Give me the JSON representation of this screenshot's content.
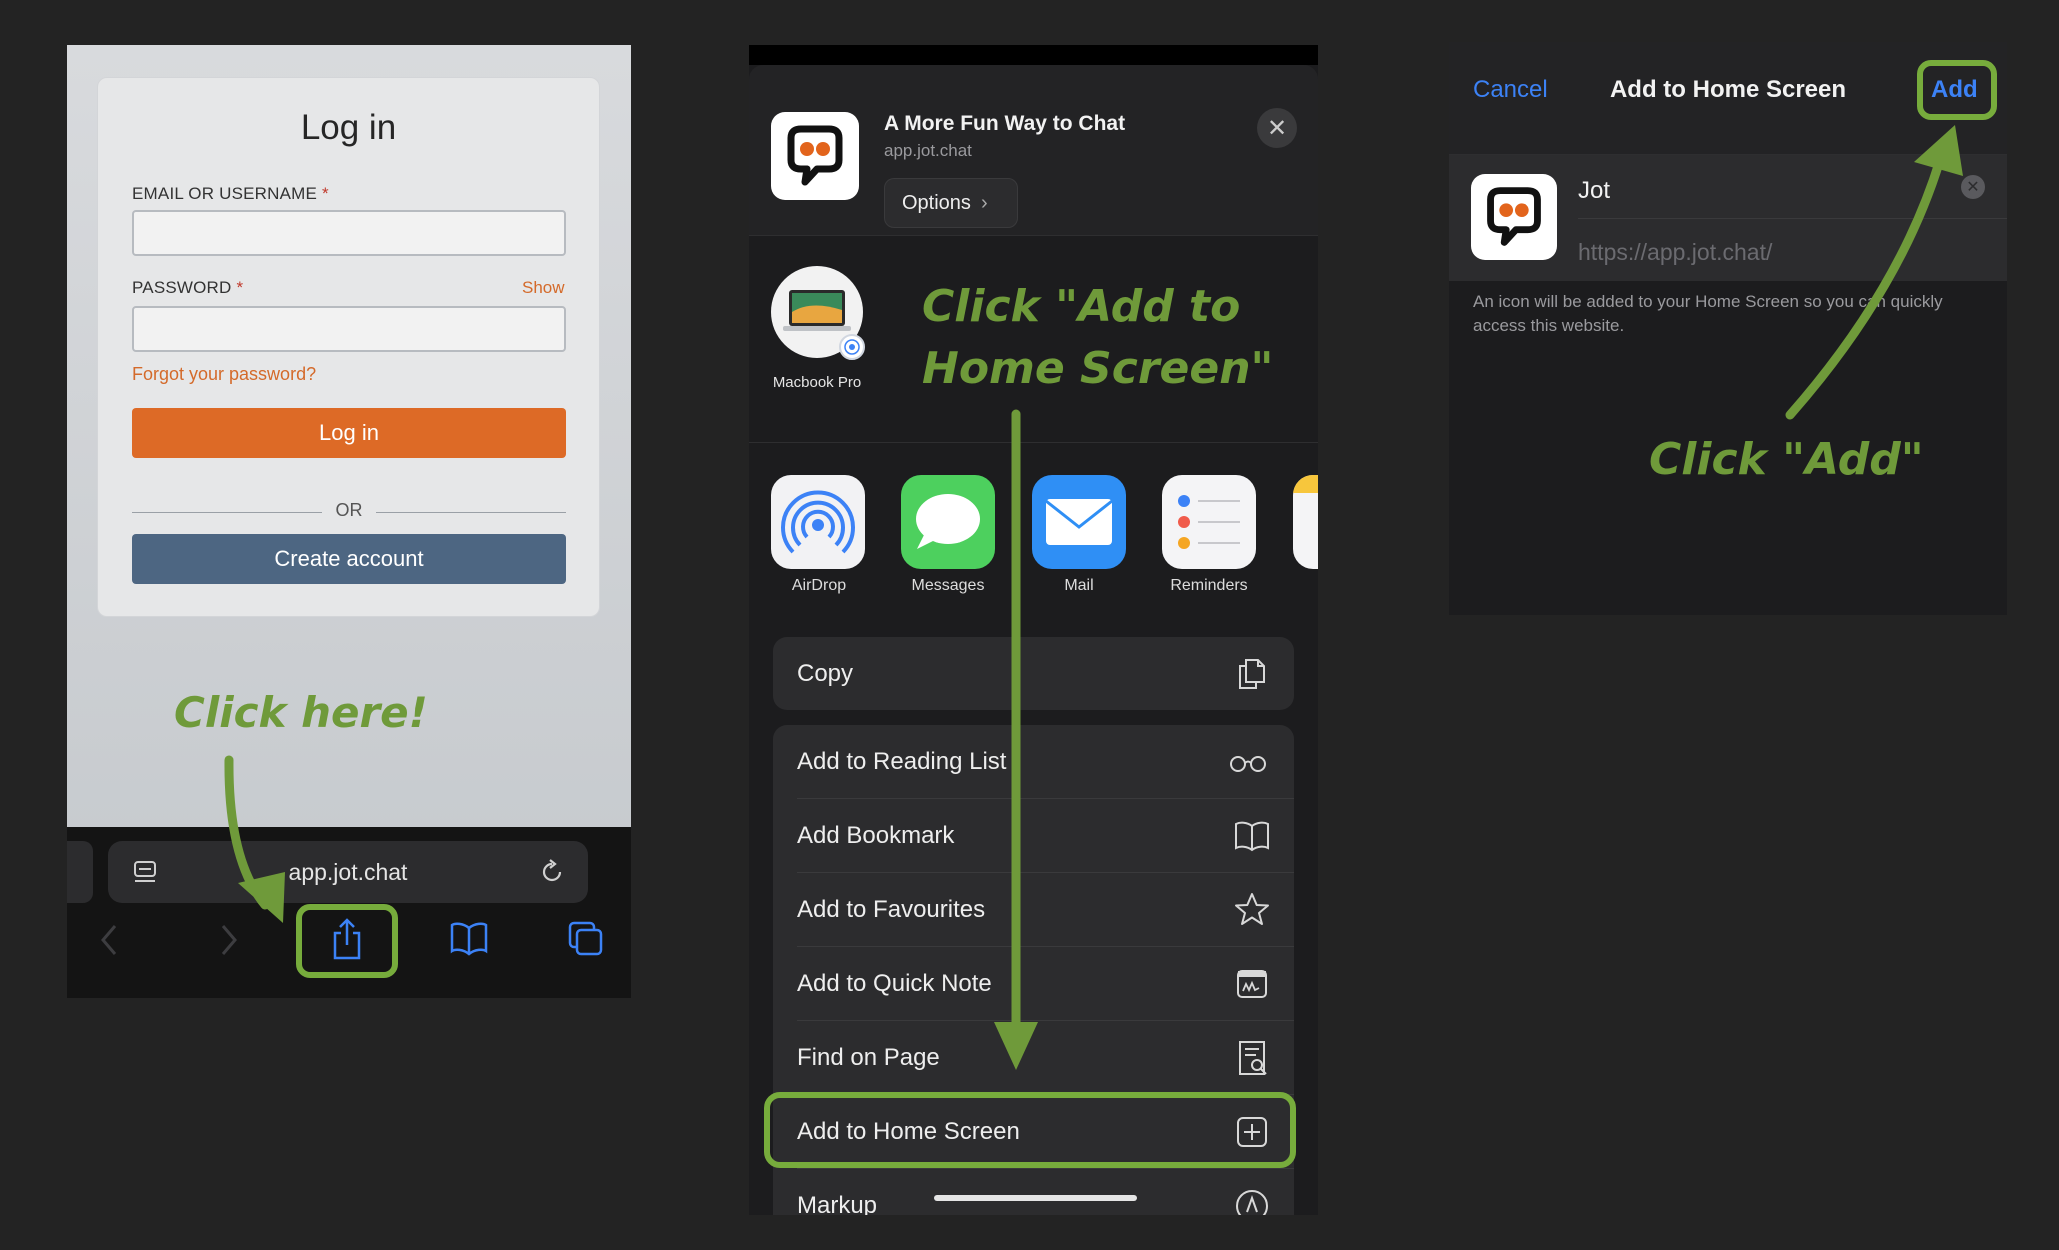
{
  "colors": {
    "background": "#232323",
    "annotation_green": "#6f9a3a",
    "highlight_green": "#77ac3c",
    "ios_blue": "#3c82f6",
    "login_orange": "#dd6a26",
    "create_blue": "#4d6682"
  },
  "panel1": {
    "login": {
      "title": "Log in",
      "email_label": "EMAIL OR USERNAME",
      "password_label": "PASSWORD",
      "required_mark": "*",
      "show_label": "Show",
      "forgot_label": "Forgot your password?",
      "login_button": "Log in",
      "or_label": "OR",
      "create_button": "Create account"
    },
    "annotation": "Click here!",
    "safari": {
      "url": "app.jot.chat",
      "icons": [
        "reader-icon",
        "reload-icon",
        "back-icon",
        "forward-icon",
        "share-icon",
        "bookmarks-icon",
        "tabs-icon"
      ]
    }
  },
  "panel2": {
    "header": {
      "title": "A More Fun Way to Chat",
      "subtitle": "app.jot.chat",
      "options_label": "Options",
      "close_icon": "close-icon"
    },
    "airdrop_device": {
      "label": "Macbook Pro"
    },
    "annotation_line1": "Click \"Add to",
    "annotation_line2": "Home Screen\"",
    "apps": [
      {
        "label": "AirDrop"
      },
      {
        "label": "Messages"
      },
      {
        "label": "Mail"
      },
      {
        "label": "Reminders"
      }
    ],
    "copy_row": {
      "label": "Copy",
      "icon": "copy-icon"
    },
    "actions": [
      {
        "label": "Add to Reading List",
        "icon": "glasses-icon"
      },
      {
        "label": "Add Bookmark",
        "icon": "book-icon"
      },
      {
        "label": "Add to Favourites",
        "icon": "star-icon"
      },
      {
        "label": "Add to Quick Note",
        "icon": "quick-note-icon"
      },
      {
        "label": "Find on Page",
        "icon": "find-icon"
      },
      {
        "label": "Add to Home Screen",
        "icon": "plus-square-icon"
      },
      {
        "label": "Markup",
        "icon": "markup-icon"
      }
    ]
  },
  "panel3": {
    "nav": {
      "cancel": "Cancel",
      "title": "Add to Home Screen",
      "add": "Add"
    },
    "name_value": "Jot",
    "url_value": "https://app.jot.chat/",
    "description": "An icon will be added to your Home Screen so you can quickly access this website.",
    "annotation": "Click \"Add\""
  }
}
